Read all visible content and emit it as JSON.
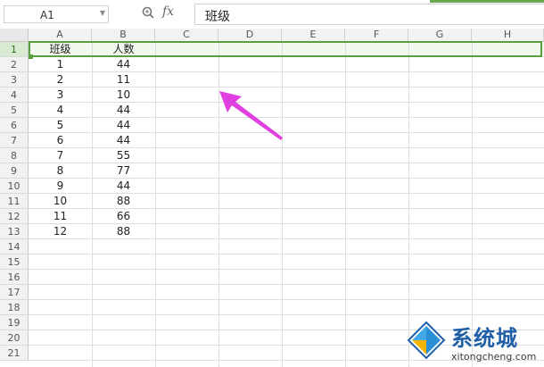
{
  "formula_bar": {
    "name_box": "A1",
    "fx_label": "fx",
    "formula_value": "班级"
  },
  "columns": [
    "A",
    "B",
    "C",
    "D",
    "E",
    "F",
    "G",
    "H"
  ],
  "rows": [
    "1",
    "2",
    "3",
    "4",
    "5",
    "6",
    "7",
    "8",
    "9",
    "10",
    "11",
    "12",
    "13",
    "14",
    "15",
    "16",
    "17",
    "18",
    "19",
    "20",
    "21"
  ],
  "table": {
    "headers": [
      "班级",
      "人数"
    ],
    "data": [
      [
        "1",
        "44"
      ],
      [
        "2",
        "11"
      ],
      [
        "3",
        "10"
      ],
      [
        "4",
        "44"
      ],
      [
        "5",
        "44"
      ],
      [
        "6",
        "44"
      ],
      [
        "7",
        "55"
      ],
      [
        "8",
        "77"
      ],
      [
        "9",
        "44"
      ],
      [
        "10",
        "88"
      ],
      [
        "11",
        "66"
      ],
      [
        "12",
        "88"
      ]
    ]
  },
  "selection": {
    "row": "1",
    "active_cell": "A1"
  },
  "colors": {
    "selection": "#5a9e3f",
    "arrow": "#e040e0",
    "watermark": "#1f5fa8"
  },
  "icons": {
    "zoom": "magnifier-icon",
    "dropdown": "chevron-down-icon"
  },
  "watermark": {
    "title": "系统城",
    "url": "xitongcheng.com"
  }
}
